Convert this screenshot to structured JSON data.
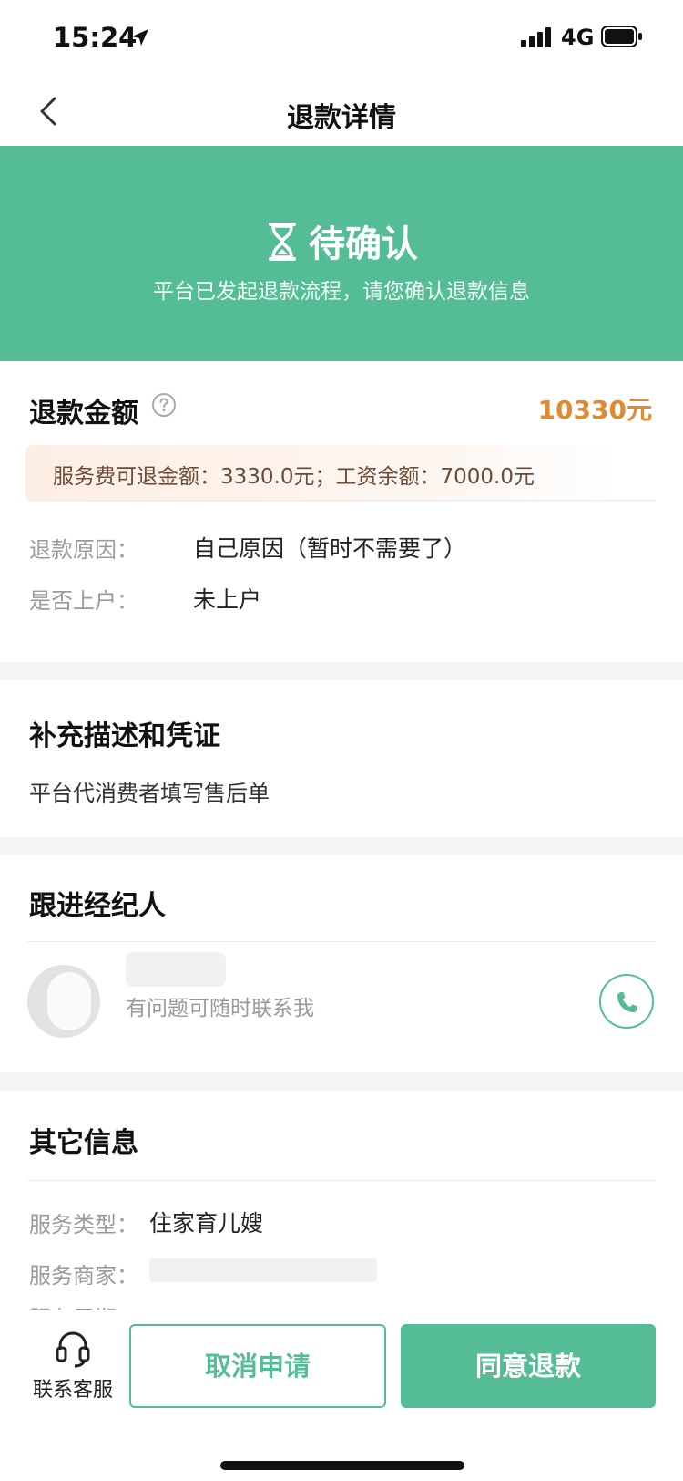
{
  "status_bar": {
    "time": "15:24",
    "network": "4G"
  },
  "nav": {
    "title": "退款详情"
  },
  "hero": {
    "status": "待确认",
    "subtitle": "平台已发起退款流程，请您确认退款信息"
  },
  "refund": {
    "title": "退款金额",
    "amount": "10330元",
    "note": "服务费可退金额：3330.0元；工资余额：7000.0元",
    "reason_label": "退款原因：",
    "reason_value": "自己原因（暂时不需要了）",
    "registered_label": "是否上户：",
    "registered_value": "未上户"
  },
  "supplement": {
    "title": "补充描述和凭证",
    "text": "平台代消费者填写售后单"
  },
  "agent": {
    "title": "跟进经纪人",
    "subtitle": "有问题可随时联系我"
  },
  "other": {
    "title": "其它信息",
    "service_type_label": "服务类型：",
    "service_type_value": "住家育儿嫂",
    "merchant_label": "服务商家：",
    "period_label": "服务周期："
  },
  "bottom": {
    "customer_service": "联系客服",
    "cancel": "取消申请",
    "agree": "同意退款"
  },
  "colors": {
    "primary": "#55bd95",
    "amount": "#e08a32"
  }
}
